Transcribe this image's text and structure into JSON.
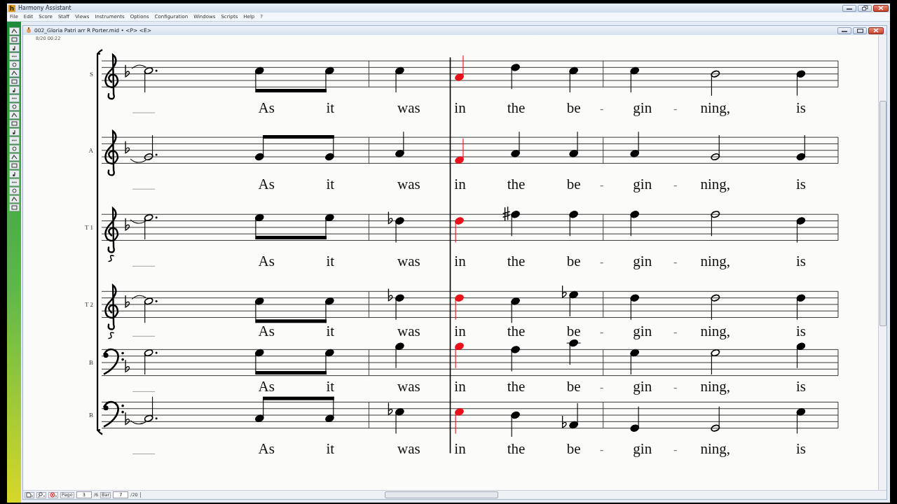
{
  "app_window": {
    "logo": "h",
    "title": "Harmony Assistant"
  },
  "menu": [
    "File",
    "Edit",
    "Score",
    "Staff",
    "Views",
    "Instruments",
    "Options",
    "Configuration",
    "Windows",
    "Scripts",
    "Help",
    "?"
  ],
  "document": {
    "title": "002_Gloria Patri arr R Porter.mid • <P> <E>",
    "info": "8/20 00:22"
  },
  "staves": [
    {
      "label": "S",
      "kind": "treble",
      "notes": [
        {
          "highlighted": false
        },
        {
          "highlighted": false
        },
        {
          "highlighted": false
        },
        {
          "highlighted": false
        },
        {
          "highlighted": true
        },
        {
          "highlighted": false
        },
        {
          "highlighted": false
        },
        {
          "highlighted": false
        },
        {
          "highlighted": false
        },
        {
          "highlighted": false
        }
      ],
      "lyrics": [
        "As",
        "it",
        "was",
        "in",
        "the",
        "be",
        "-",
        "gin",
        "-",
        "ning,",
        "is"
      ]
    },
    {
      "label": "A",
      "kind": "treble",
      "notes": [
        {
          "highlighted": false
        },
        {
          "highlighted": false
        },
        {
          "highlighted": false
        },
        {
          "highlighted": false
        },
        {
          "highlighted": true
        },
        {
          "highlighted": false
        },
        {
          "highlighted": false
        },
        {
          "highlighted": false
        },
        {
          "highlighted": false
        },
        {
          "highlighted": false
        }
      ],
      "lyrics": [
        "As",
        "it",
        "was",
        "in",
        "the",
        "be",
        "-",
        "gin",
        "-",
        "ning,",
        "is"
      ]
    },
    {
      "label": "T 1",
      "kind": "treble_8",
      "notes": [
        {
          "highlighted": false
        },
        {
          "highlighted": false
        },
        {
          "highlighted": false
        },
        {
          "highlighted": false
        },
        {
          "highlighted": true
        },
        {
          "highlighted": false
        },
        {
          "highlighted": false
        },
        {
          "highlighted": false
        },
        {
          "highlighted": false
        },
        {
          "highlighted": false
        }
      ],
      "lyrics": [
        "As",
        "it",
        "was",
        "in",
        "the",
        "be",
        "-",
        "gin",
        "-",
        "ning,",
        "is"
      ]
    },
    {
      "label": "T 2",
      "kind": "treble_8",
      "notes": [
        {
          "highlighted": false
        },
        {
          "highlighted": false
        },
        {
          "highlighted": false
        },
        {
          "highlighted": false
        },
        {
          "highlighted": true
        },
        {
          "highlighted": false
        },
        {
          "highlighted": false
        },
        {
          "highlighted": false
        },
        {
          "highlighted": false
        },
        {
          "highlighted": false
        }
      ],
      "lyrics": [
        "As",
        "it",
        "was",
        "in",
        "the",
        "be",
        "-",
        "gin",
        "-",
        "ning,",
        "is"
      ]
    },
    {
      "label": "B",
      "kind": "bass",
      "notes": [
        {
          "highlighted": false
        },
        {
          "highlighted": false
        },
        {
          "highlighted": false
        },
        {
          "highlighted": false
        },
        {
          "highlighted": true
        },
        {
          "highlighted": false
        },
        {
          "highlighted": false
        },
        {
          "highlighted": false
        },
        {
          "highlighted": false
        },
        {
          "highlighted": false
        }
      ],
      "lyrics": [
        "As",
        "it",
        "was",
        "in",
        "the",
        "be",
        "-",
        "gin",
        "-",
        "ning,",
        "is"
      ]
    },
    {
      "label": "B",
      "kind": "bass",
      "notes": [
        {
          "highlighted": false
        },
        {
          "highlighted": false
        },
        {
          "highlighted": false
        },
        {
          "highlighted": false
        },
        {
          "highlighted": true
        },
        {
          "highlighted": false
        },
        {
          "highlighted": false
        },
        {
          "highlighted": false
        },
        {
          "highlighted": false
        },
        {
          "highlighted": false
        }
      ],
      "lyrics": [
        "As",
        "it",
        "was",
        "in",
        "the",
        "be",
        "-",
        "gin",
        "-",
        "ning,",
        "is"
      ]
    }
  ],
  "status_bar": {
    "page_label": "Page",
    "page": "3",
    "page_total": "/6",
    "bar_label": "Bar",
    "bar": "7",
    "bar_total": "/20"
  }
}
